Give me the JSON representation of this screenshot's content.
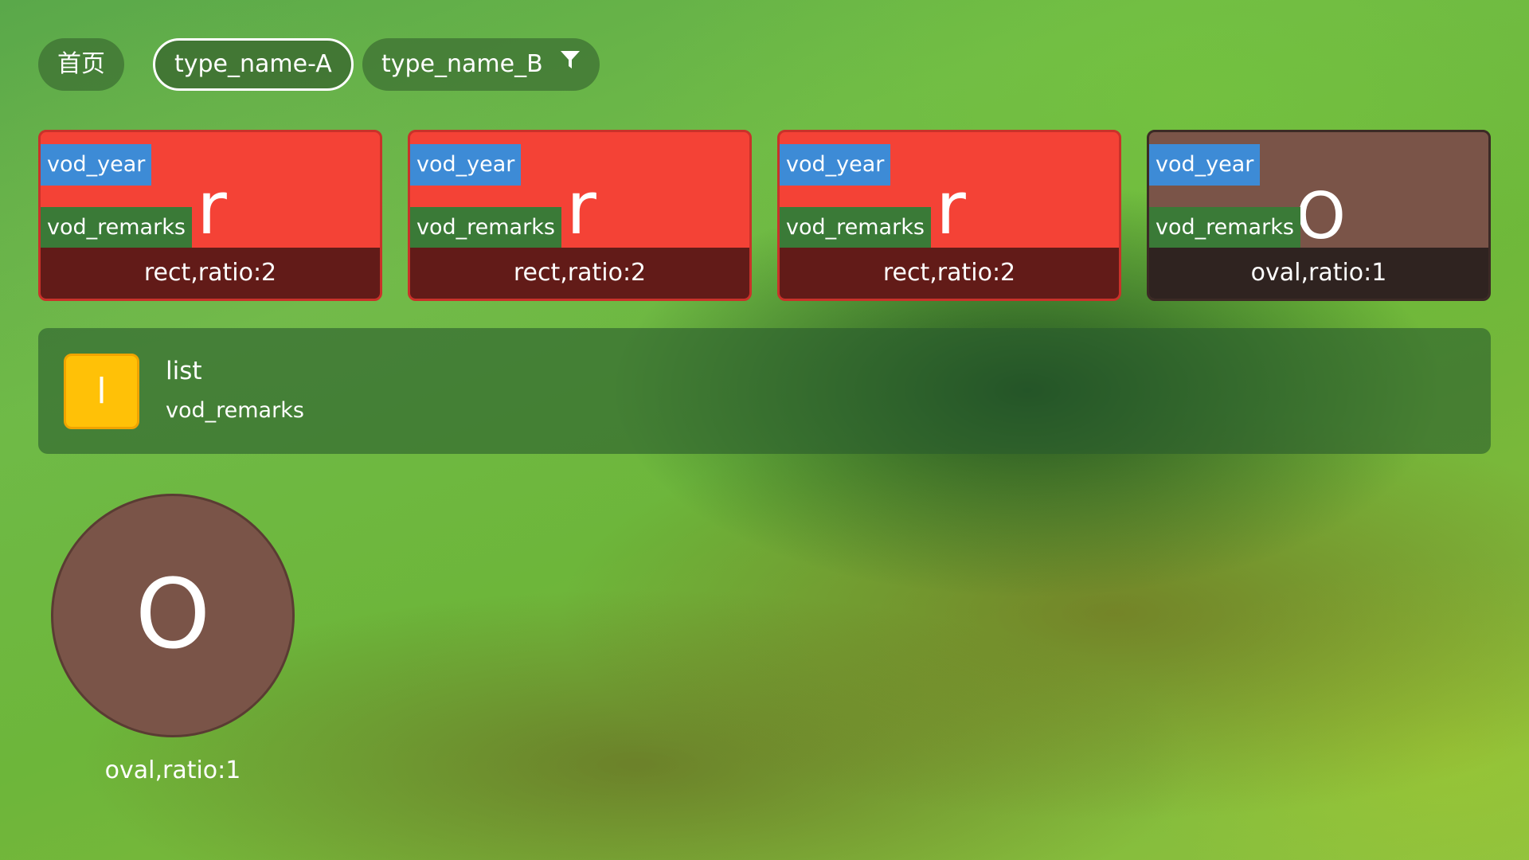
{
  "tabs": [
    {
      "label": "首页"
    },
    {
      "label": "type_name-A"
    },
    {
      "label": "type_name_B"
    }
  ],
  "cards": [
    {
      "letter": "r",
      "year": "vod_year",
      "remarks": "vod_remarks",
      "caption": "rect,ratio:2",
      "color": "#f44236"
    },
    {
      "letter": "r",
      "year": "vod_year",
      "remarks": "vod_remarks",
      "caption": "rect,ratio:2",
      "color": "#f44236"
    },
    {
      "letter": "r",
      "year": "vod_year",
      "remarks": "vod_remarks",
      "caption": "rect,ratio:2",
      "color": "#f44236"
    },
    {
      "letter": "O",
      "year": "vod_year",
      "remarks": "vod_remarks",
      "caption": "oval,ratio:1",
      "color": "#7a5448"
    }
  ],
  "list_item": {
    "thumb_letter": "l",
    "title": "list",
    "subtitle": "vod_remarks",
    "color": "#ffc107"
  },
  "oval_item": {
    "letter": "O",
    "caption": "oval,ratio:1",
    "color": "#7a5448"
  },
  "icons": {
    "filter": "filter-icon"
  }
}
